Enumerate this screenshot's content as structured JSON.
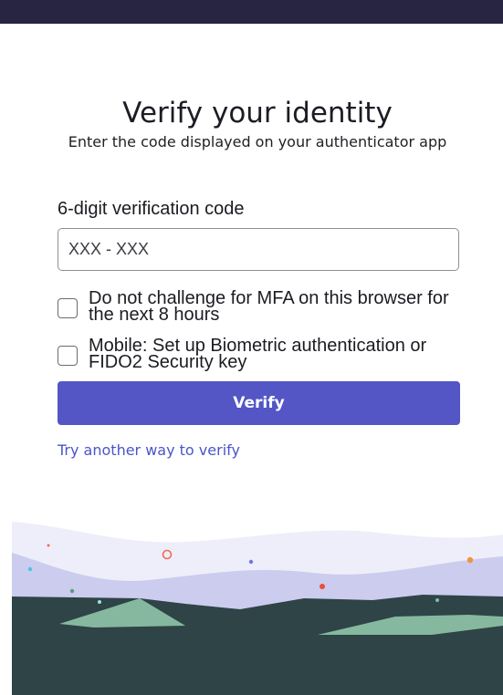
{
  "page": {
    "title": "Verify your identity",
    "subtitle": "Enter the code displayed on your authenticator app"
  },
  "form": {
    "code_label": "6-digit verification code",
    "code_placeholder": "XXX - XXX",
    "code_value": "",
    "remember_label": "Do not challenge for MFA on this browser for the next 8 hours",
    "remember_checked": false,
    "biometric_label": "Mobile: Set up Biometric authentication or FIDO2 Security key",
    "biometric_checked": false,
    "verify_label": "Verify",
    "alt_link_label": "Try another way to verify"
  },
  "colors": {
    "top_bar": "#272542",
    "primary_button": "#5356c4",
    "link": "#4a55c8",
    "mountain": "#2e4446",
    "hill_green": "#86b8a0",
    "sky_wave": "#c9cbec"
  }
}
